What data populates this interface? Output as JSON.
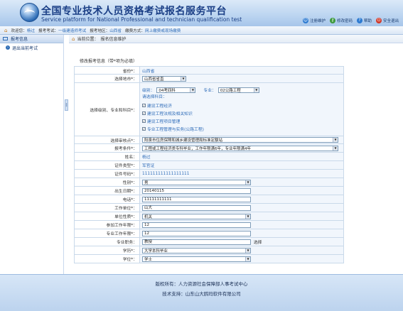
{
  "header": {
    "title": "全国专业技术人员资格考试报名服务平台",
    "subtitle": "Service platform for National Professional and technician qualification test",
    "links": [
      {
        "label": "注册维护",
        "icon": "user-icon",
        "color": "#2e7bd1"
      },
      {
        "label": "修改密码",
        "icon": "key-icon",
        "color": "#3d9a3d"
      },
      {
        "label": "帮助",
        "icon": "help-icon",
        "color": "#2e7bd1"
      },
      {
        "label": "安全退出",
        "icon": "power-icon",
        "color": "#d23a2a"
      }
    ]
  },
  "infobar": {
    "welcome_label": "欢迎您：",
    "user": "杨过",
    "exam_label": "报考考试：",
    "exam": "一级建造师考试",
    "region_label": "报考地区：",
    "region": "山西省",
    "pay_label": "缴费方式：",
    "pay": "网上缴费或现场缴费"
  },
  "sidebar": {
    "header": "报考信息",
    "item": "退出当前考试"
  },
  "breadcrumb": {
    "label": "当前位置：",
    "path": "报名信息维护"
  },
  "form": {
    "title": "修改报考信息（带*项为必填）",
    "province_label": "省份*：",
    "province": "山西省",
    "city_label": "选择地市*：",
    "city": "山西省省直",
    "subject_label": "选择级别、专业和科目*：",
    "level_label": "级别：",
    "level": "04考四科",
    "major_label": "专业：",
    "major": "02公路工程",
    "subjects_label": "请选择科目：",
    "subjects": [
      "建设工程经济",
      "建设工程法规及相关知识",
      "建设工程项目管理",
      "专业工程管理与实务(公路工程)"
    ],
    "audit_label": "选择审核点*：",
    "audit": "阳泉市住房保障和城乡建设管理局标准定额站",
    "condition_label": "报考条件*：",
    "condition": "工程或工程经济类专科毕业，工作年限满6年，专业年限满4年",
    "name_label": "姓名：",
    "name": "杨过",
    "idtype_label": "证件类型*：",
    "idtype": "军官证",
    "idno_label": "证件号码*：",
    "idno": "111111111111111111",
    "gender_label": "性别*：",
    "gender": "男",
    "birth_label": "出生日期*：",
    "birth": "20140115",
    "phone_label": "电话*：",
    "phone": "11111111111",
    "company_label": "工作单位*：",
    "company": "山大",
    "unit_type_label": "单位性质*：",
    "unit_type": "机关",
    "work_years_label": "参加工作年限*：",
    "work_years": "12",
    "prof_years_label": "专业工作年限*：",
    "prof_years": "12",
    "title_label": "专业职务：",
    "prof_title": "教授",
    "select_btn": "选择",
    "degree_label": "学历*：",
    "degree": "大学本科毕业",
    "xuewei_label": "学位*：",
    "xuewei": "学士"
  },
  "footer": {
    "copyright": "版权所有：人力资源社会保障部人事考试中心",
    "tech": "技术支持：山东山大鸥玛软件有限公司"
  }
}
